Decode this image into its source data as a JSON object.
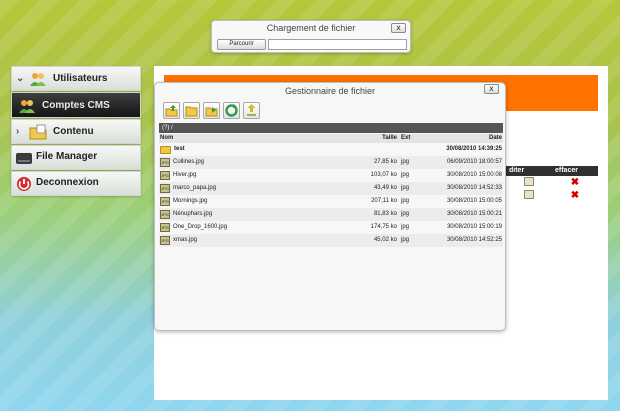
{
  "upload": {
    "title": "Chargement de fichier",
    "browse_label": "Parcourir",
    "close_label": "x"
  },
  "sidebar": {
    "items": [
      {
        "label": "Utilisateurs",
        "icon": "users-icon"
      },
      {
        "label": "Comptes CMS",
        "icon": "users-icon"
      },
      {
        "label": "Contenu",
        "icon": "folder-icon"
      },
      {
        "label": "File Manager",
        "icon": "drive-icon"
      },
      {
        "label": "Deconnexion",
        "icon": "power-icon"
      }
    ]
  },
  "background_table": {
    "headers": [
      "diter",
      "effacer"
    ]
  },
  "file_manager": {
    "title": "Gestionnaire de fichier",
    "close_label": "x",
    "toolbar": [
      "up-folder-icon",
      "open-folder-icon",
      "new-folder-icon",
      "refresh-icon",
      "upload-icon"
    ],
    "path": "(?) /",
    "columns": {
      "name": "Nom",
      "size": "Taille",
      "ext": "Ext",
      "date": "Date"
    },
    "folder": {
      "name": "test",
      "date": "30/08/2010 14:39:25"
    },
    "files": [
      {
        "name": "Collines.jpg",
        "size": "27,85 ko",
        "ext": "jpg",
        "date": "06/09/2010 18:00:57"
      },
      {
        "name": "Hiver.jpg",
        "size": "103,07 ko",
        "ext": "jpg",
        "date": "30/08/2010 15:00:08"
      },
      {
        "name": "marco_papa.jpg",
        "size": "43,49 ko",
        "ext": "jpg",
        "date": "30/08/2010 14:52:33"
      },
      {
        "name": "Mornings.jpg",
        "size": "207,11 ko",
        "ext": "jpg",
        "date": "30/08/2010 15:00:05"
      },
      {
        "name": "Nénuphars.jpg",
        "size": "81,83 ko",
        "ext": "jpg",
        "date": "30/08/2010 15:00:21"
      },
      {
        "name": "One_Drop_1600.jpg",
        "size": "174,75 ko",
        "ext": "jpg",
        "date": "30/08/2010 15:00:19"
      },
      {
        "name": "xmas.jpg",
        "size": "45,02 ko",
        "ext": "jpg",
        "date": "30/08/2010 14:52:25"
      }
    ]
  }
}
